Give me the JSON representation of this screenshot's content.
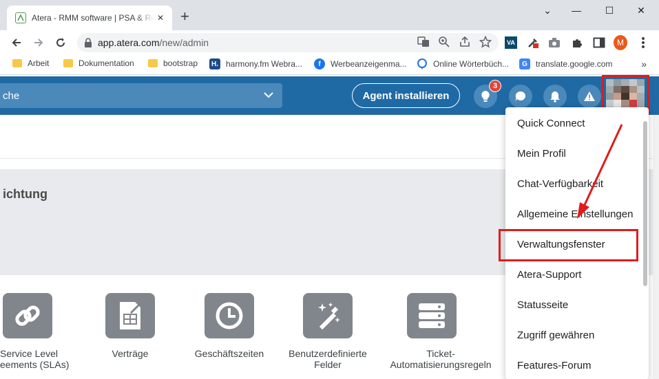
{
  "browser": {
    "tab_title": "Atera - RMM software | PSA & Re",
    "tab_close": "✕",
    "new_tab": "+",
    "window_controls": {
      "minimize": "—",
      "maximize": "☐",
      "close": "✕",
      "tabsearch": "⌄"
    },
    "url_host": "app.atera.com",
    "url_path": "/new/admin",
    "profile_initial": "M",
    "bookmarks": [
      {
        "label": "Arbeit",
        "icon": "folder-icon"
      },
      {
        "label": "Dokumentation",
        "icon": "folder-icon"
      },
      {
        "label": "bootstrap",
        "icon": "folder-icon"
      },
      {
        "label": "harmony.fm Webra...",
        "icon": "harmony-icon"
      },
      {
        "label": "Werbeanzeigenma...",
        "icon": "facebook-icon"
      },
      {
        "label": "Online Wörterbüch...",
        "icon": "dictionary-icon"
      },
      {
        "label": "translate.google.com",
        "icon": "google-translate-icon"
      }
    ],
    "bookmarks_more": "»"
  },
  "header": {
    "search_text": "che",
    "agent_button": "Agent installieren",
    "notification_badge": "3"
  },
  "page": {
    "section_title": "ichtung",
    "tiles": [
      {
        "label1": "Service Level",
        "label2": "eements (SLAs)"
      },
      {
        "label1": "Verträge",
        "label2": ""
      },
      {
        "label1": "Geschäftszeiten",
        "label2": ""
      },
      {
        "label1": "Benutzerdefinierte",
        "label2": "Felder"
      },
      {
        "label1": "Ticket-",
        "label2": "Automatisierungsregeln"
      }
    ]
  },
  "menu": {
    "items": [
      "Quick Connect",
      "Mein Profil",
      "Chat-Verfügbarkeit",
      "Allgemeine Einstellungen",
      "Verwaltungsfenster",
      "Atera-Support",
      "Statusseite",
      "Zugriff gewähren",
      "Features-Forum"
    ]
  },
  "colors": {
    "atera_blue": "#1f6aa5",
    "annotation_red": "#e01b1b",
    "tile_gray": "#80868b"
  }
}
